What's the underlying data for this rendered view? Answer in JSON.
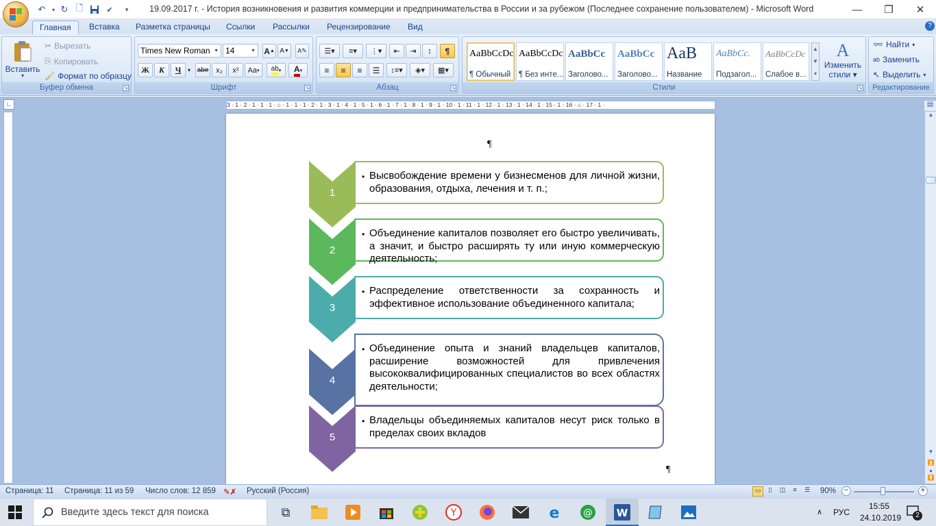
{
  "window": {
    "title": "19.09.2017 г. - История возникновения и развития коммерции и предпринимательства в России и за рубежом (Последнее сохранение пользователем) - Microsoft Word"
  },
  "tabs": [
    "Главная",
    "Вставка",
    "Разметка страницы",
    "Ссылки",
    "Рассылки",
    "Рецензирование",
    "Вид"
  ],
  "clipboard": {
    "paste": "Вставить",
    "cut": "Вырезать",
    "copy": "Копировать",
    "format_painter": "Формат по образцу",
    "label": "Буфер обмена"
  },
  "font": {
    "name": "Times New Roman",
    "size": "14",
    "label": "Шрифт",
    "bold": "Ж",
    "italic": "К",
    "underline": "Ч",
    "strike": "abe",
    "subscript": "x₂",
    "superscript": "x²",
    "change_case": "Aa",
    "grow": "A",
    "shrink": "A"
  },
  "paragraph": {
    "label": "Абзац",
    "pilcrow": "¶"
  },
  "styles": {
    "label": "Стили",
    "items": [
      {
        "sample": "AaBbCcDc",
        "name": "¶ Обычный"
      },
      {
        "sample": "AaBbCcDc",
        "name": "¶ Без инте..."
      },
      {
        "sample": "AaBbCc",
        "name": "Заголово..."
      },
      {
        "sample": "AaBbCc",
        "name": "Заголово..."
      },
      {
        "sample": "AaB",
        "name": "Название"
      },
      {
        "sample": "AaBbCc.",
        "name": "Подзагол..."
      },
      {
        "sample": "AaBbCcDc",
        "name": "Слабое в..."
      }
    ],
    "change_styles_1": "Изменить",
    "change_styles_2": "стили"
  },
  "editing": {
    "label": "Редактирование",
    "find": "Найти",
    "replace": "Заменить",
    "select": "Выделить"
  },
  "ruler_text": "3 · 1 · 2 · 1 · 1 · 1 · ⌂ · 1 · 1 · 1 · 2 · 1 · 3 · 1 · 4 · 1 · 5 · 1 · 6 · 1 · 7 · 1 · 8 · 1 · 9 · 1 · 10 · 1 · 11 · 1 · 12 · 1 · 13 · 1 · 14 · 1 · 15 · 1 · 16 · ⌂ · 17 · 1 ·",
  "document": {
    "pilcrow_top": "¶",
    "pilcrow_bottom": "¶",
    "steps": [
      {
        "num": "1",
        "color": "#9bbb59",
        "border": "#9bbb59",
        "text": "Высвобождение времени у бизнесменов для личной жизни, образования, отдыха, лечения и т. п.;"
      },
      {
        "num": "2",
        "color": "#5cb85c",
        "border": "#5cb85c",
        "text": "Объединение капиталов позволяет его быстро увеличивать, а значит, и быстро расширять ту или иную коммерческую деятельность;"
      },
      {
        "num": "3",
        "color": "#4bacab",
        "border": "#4bacab",
        "text": "Распределение ответственности за сохранность и эффективное использование объединенного капитала;"
      },
      {
        "num": "4",
        "color": "#5873a3",
        "border": "#5873a3",
        "text": "Объединение опыта и знаний владельцев капиталов, расширение возможностей для привлечения высококвалифицированных специалистов во всех областях деятельности;"
      },
      {
        "num": "5",
        "color": "#8064a2",
        "border": "#8064a2",
        "text": "Владельцы объединяемых капиталов несут риск только в пределах своих вкладов"
      }
    ]
  },
  "status": {
    "page": "Страница: 11",
    "pages": "Страница: 11 из 59",
    "words": "Число слов: 12 859",
    "language": "Русский (Россия)",
    "zoom": "90%"
  },
  "taskbar": {
    "search_placeholder": "Введите здесь текст для поиска",
    "lang": "РУС",
    "time": "15:55",
    "date": "24.10.2019",
    "notifications": "2"
  }
}
